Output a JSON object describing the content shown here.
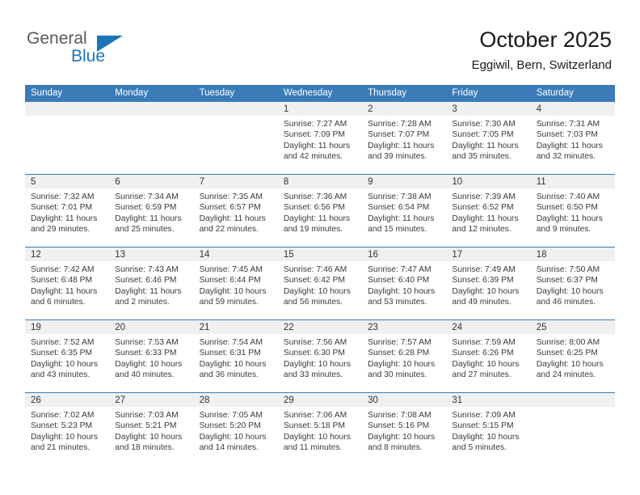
{
  "brand": {
    "name_top": "General",
    "name_bottom": "Blue"
  },
  "header": {
    "title": "October 2025",
    "subtitle": "Eggiwil, Bern, Switzerland"
  },
  "colors": {
    "header_blue": "#3b7cb8",
    "brand_blue": "#1b75bb",
    "daynum_bg": "#f0f0f0",
    "text": "#3a3a3a"
  },
  "weekdays": [
    "Sunday",
    "Monday",
    "Tuesday",
    "Wednesday",
    "Thursday",
    "Friday",
    "Saturday"
  ],
  "weeks": [
    [
      {
        "day": "",
        "sunrise": "",
        "sunset": "",
        "daylight1": "",
        "daylight2": ""
      },
      {
        "day": "",
        "sunrise": "",
        "sunset": "",
        "daylight1": "",
        "daylight2": ""
      },
      {
        "day": "",
        "sunrise": "",
        "sunset": "",
        "daylight1": "",
        "daylight2": ""
      },
      {
        "day": "1",
        "sunrise": "Sunrise: 7:27 AM",
        "sunset": "Sunset: 7:09 PM",
        "daylight1": "Daylight: 11 hours",
        "daylight2": "and 42 minutes."
      },
      {
        "day": "2",
        "sunrise": "Sunrise: 7:28 AM",
        "sunset": "Sunset: 7:07 PM",
        "daylight1": "Daylight: 11 hours",
        "daylight2": "and 39 minutes."
      },
      {
        "day": "3",
        "sunrise": "Sunrise: 7:30 AM",
        "sunset": "Sunset: 7:05 PM",
        "daylight1": "Daylight: 11 hours",
        "daylight2": "and 35 minutes."
      },
      {
        "day": "4",
        "sunrise": "Sunrise: 7:31 AM",
        "sunset": "Sunset: 7:03 PM",
        "daylight1": "Daylight: 11 hours",
        "daylight2": "and 32 minutes."
      }
    ],
    [
      {
        "day": "5",
        "sunrise": "Sunrise: 7:32 AM",
        "sunset": "Sunset: 7:01 PM",
        "daylight1": "Daylight: 11 hours",
        "daylight2": "and 29 minutes."
      },
      {
        "day": "6",
        "sunrise": "Sunrise: 7:34 AM",
        "sunset": "Sunset: 6:59 PM",
        "daylight1": "Daylight: 11 hours",
        "daylight2": "and 25 minutes."
      },
      {
        "day": "7",
        "sunrise": "Sunrise: 7:35 AM",
        "sunset": "Sunset: 6:57 PM",
        "daylight1": "Daylight: 11 hours",
        "daylight2": "and 22 minutes."
      },
      {
        "day": "8",
        "sunrise": "Sunrise: 7:36 AM",
        "sunset": "Sunset: 6:56 PM",
        "daylight1": "Daylight: 11 hours",
        "daylight2": "and 19 minutes."
      },
      {
        "day": "9",
        "sunrise": "Sunrise: 7:38 AM",
        "sunset": "Sunset: 6:54 PM",
        "daylight1": "Daylight: 11 hours",
        "daylight2": "and 15 minutes."
      },
      {
        "day": "10",
        "sunrise": "Sunrise: 7:39 AM",
        "sunset": "Sunset: 6:52 PM",
        "daylight1": "Daylight: 11 hours",
        "daylight2": "and 12 minutes."
      },
      {
        "day": "11",
        "sunrise": "Sunrise: 7:40 AM",
        "sunset": "Sunset: 6:50 PM",
        "daylight1": "Daylight: 11 hours",
        "daylight2": "and 9 minutes."
      }
    ],
    [
      {
        "day": "12",
        "sunrise": "Sunrise: 7:42 AM",
        "sunset": "Sunset: 6:48 PM",
        "daylight1": "Daylight: 11 hours",
        "daylight2": "and 6 minutes."
      },
      {
        "day": "13",
        "sunrise": "Sunrise: 7:43 AM",
        "sunset": "Sunset: 6:46 PM",
        "daylight1": "Daylight: 11 hours",
        "daylight2": "and 2 minutes."
      },
      {
        "day": "14",
        "sunrise": "Sunrise: 7:45 AM",
        "sunset": "Sunset: 6:44 PM",
        "daylight1": "Daylight: 10 hours",
        "daylight2": "and 59 minutes."
      },
      {
        "day": "15",
        "sunrise": "Sunrise: 7:46 AM",
        "sunset": "Sunset: 6:42 PM",
        "daylight1": "Daylight: 10 hours",
        "daylight2": "and 56 minutes."
      },
      {
        "day": "16",
        "sunrise": "Sunrise: 7:47 AM",
        "sunset": "Sunset: 6:40 PM",
        "daylight1": "Daylight: 10 hours",
        "daylight2": "and 53 minutes."
      },
      {
        "day": "17",
        "sunrise": "Sunrise: 7:49 AM",
        "sunset": "Sunset: 6:39 PM",
        "daylight1": "Daylight: 10 hours",
        "daylight2": "and 49 minutes."
      },
      {
        "day": "18",
        "sunrise": "Sunrise: 7:50 AM",
        "sunset": "Sunset: 6:37 PM",
        "daylight1": "Daylight: 10 hours",
        "daylight2": "and 46 minutes."
      }
    ],
    [
      {
        "day": "19",
        "sunrise": "Sunrise: 7:52 AM",
        "sunset": "Sunset: 6:35 PM",
        "daylight1": "Daylight: 10 hours",
        "daylight2": "and 43 minutes."
      },
      {
        "day": "20",
        "sunrise": "Sunrise: 7:53 AM",
        "sunset": "Sunset: 6:33 PM",
        "daylight1": "Daylight: 10 hours",
        "daylight2": "and 40 minutes."
      },
      {
        "day": "21",
        "sunrise": "Sunrise: 7:54 AM",
        "sunset": "Sunset: 6:31 PM",
        "daylight1": "Daylight: 10 hours",
        "daylight2": "and 36 minutes."
      },
      {
        "day": "22",
        "sunrise": "Sunrise: 7:56 AM",
        "sunset": "Sunset: 6:30 PM",
        "daylight1": "Daylight: 10 hours",
        "daylight2": "and 33 minutes."
      },
      {
        "day": "23",
        "sunrise": "Sunrise: 7:57 AM",
        "sunset": "Sunset: 6:28 PM",
        "daylight1": "Daylight: 10 hours",
        "daylight2": "and 30 minutes."
      },
      {
        "day": "24",
        "sunrise": "Sunrise: 7:59 AM",
        "sunset": "Sunset: 6:26 PM",
        "daylight1": "Daylight: 10 hours",
        "daylight2": "and 27 minutes."
      },
      {
        "day": "25",
        "sunrise": "Sunrise: 8:00 AM",
        "sunset": "Sunset: 6:25 PM",
        "daylight1": "Daylight: 10 hours",
        "daylight2": "and 24 minutes."
      }
    ],
    [
      {
        "day": "26",
        "sunrise": "Sunrise: 7:02 AM",
        "sunset": "Sunset: 5:23 PM",
        "daylight1": "Daylight: 10 hours",
        "daylight2": "and 21 minutes."
      },
      {
        "day": "27",
        "sunrise": "Sunrise: 7:03 AM",
        "sunset": "Sunset: 5:21 PM",
        "daylight1": "Daylight: 10 hours",
        "daylight2": "and 18 minutes."
      },
      {
        "day": "28",
        "sunrise": "Sunrise: 7:05 AM",
        "sunset": "Sunset: 5:20 PM",
        "daylight1": "Daylight: 10 hours",
        "daylight2": "and 14 minutes."
      },
      {
        "day": "29",
        "sunrise": "Sunrise: 7:06 AM",
        "sunset": "Sunset: 5:18 PM",
        "daylight1": "Daylight: 10 hours",
        "daylight2": "and 11 minutes."
      },
      {
        "day": "30",
        "sunrise": "Sunrise: 7:08 AM",
        "sunset": "Sunset: 5:16 PM",
        "daylight1": "Daylight: 10 hours",
        "daylight2": "and 8 minutes."
      },
      {
        "day": "31",
        "sunrise": "Sunrise: 7:09 AM",
        "sunset": "Sunset: 5:15 PM",
        "daylight1": "Daylight: 10 hours",
        "daylight2": "and 5 minutes."
      },
      {
        "day": "",
        "sunrise": "",
        "sunset": "",
        "daylight1": "",
        "daylight2": ""
      }
    ]
  ]
}
